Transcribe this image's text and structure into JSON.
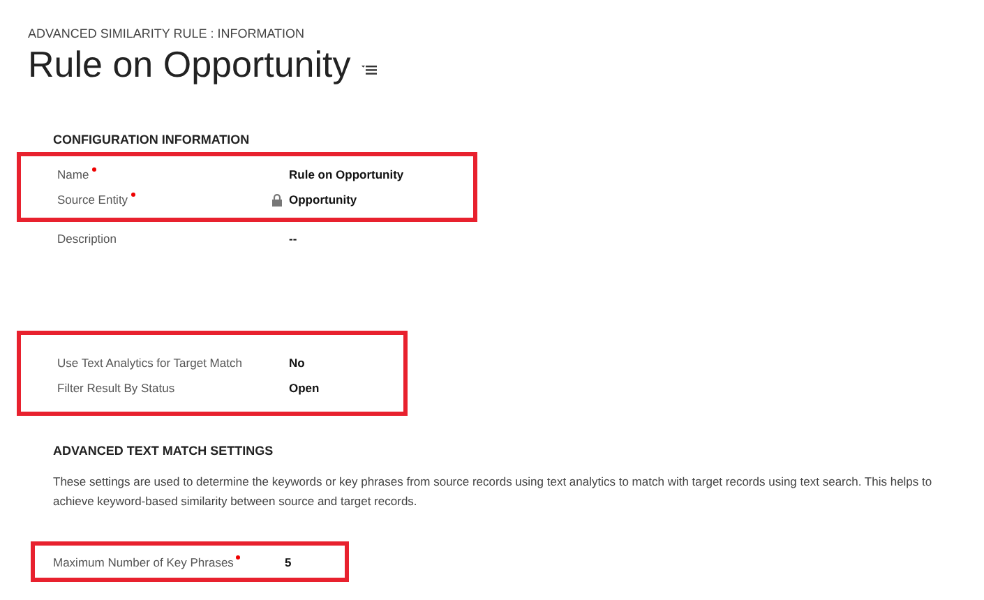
{
  "breadcrumb": "ADVANCED SIMILARITY RULE : INFORMATION",
  "title": "Rule on Opportunity",
  "sections": [
    {
      "heading": "CONFIGURATION INFORMATION",
      "groups": [
        {
          "highlighted": true,
          "fields": [
            {
              "label": "Name",
              "required": true,
              "locked": false,
              "value": "Rule on Opportunity"
            },
            {
              "label": "Source Entity",
              "required": true,
              "locked": true,
              "value": "Opportunity"
            }
          ]
        },
        {
          "highlighted": false,
          "fields": [
            {
              "label": "Description",
              "required": false,
              "locked": false,
              "value": "--"
            }
          ]
        },
        {
          "highlighted": true,
          "fields": [
            {
              "label": "Use Text Analytics for Target Match",
              "required": false,
              "locked": false,
              "value": "No"
            },
            {
              "label": "Filter Result By Status",
              "required": false,
              "locked": false,
              "value": "Open"
            }
          ]
        }
      ]
    },
    {
      "heading": "ADVANCED TEXT MATCH SETTINGS",
      "description": "These settings are used to determine the keywords or key phrases from source records using text analytics to match with target records using text search. This helps to achieve keyword-based similarity between source and target records.",
      "groups": [
        {
          "highlighted": true,
          "fields": [
            {
              "label": "Maximum Number of Key Phrases",
              "required": true,
              "locked": false,
              "value": "5"
            }
          ]
        }
      ]
    }
  ]
}
